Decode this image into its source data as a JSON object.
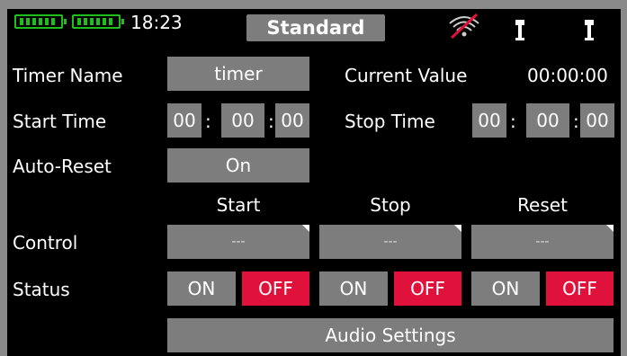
{
  "status_bar": {
    "time": "18:23",
    "mode": "Standard",
    "icons": [
      "battery-icon",
      "battery-icon",
      "wifi-off-icon",
      "sensor-icon",
      "sensor-icon"
    ]
  },
  "timer": {
    "name_label": "Timer Name",
    "name_value": "timer",
    "current_label": "Current Value",
    "current_value": "00:00:00",
    "start_label": "Start Time",
    "start_h": "00",
    "start_m": "00",
    "start_s": "00",
    "stop_label": "Stop Time",
    "stop_h": "00",
    "stop_m": "00",
    "stop_s": "00",
    "colon": ":",
    "autoreset_label": "Auto-Reset",
    "autoreset_value": "On"
  },
  "columns": [
    "Start",
    "Stop",
    "Reset"
  ],
  "control": {
    "label": "Control",
    "values": [
      "---",
      "---",
      "---"
    ]
  },
  "status": {
    "label": "Status",
    "on_label": "ON",
    "off_label": "OFF"
  },
  "audio_button": "Audio Settings",
  "colors": {
    "off_active": "#e0123c",
    "button_gray": "#7d7d7d",
    "battery_green": "#1ec01e"
  }
}
